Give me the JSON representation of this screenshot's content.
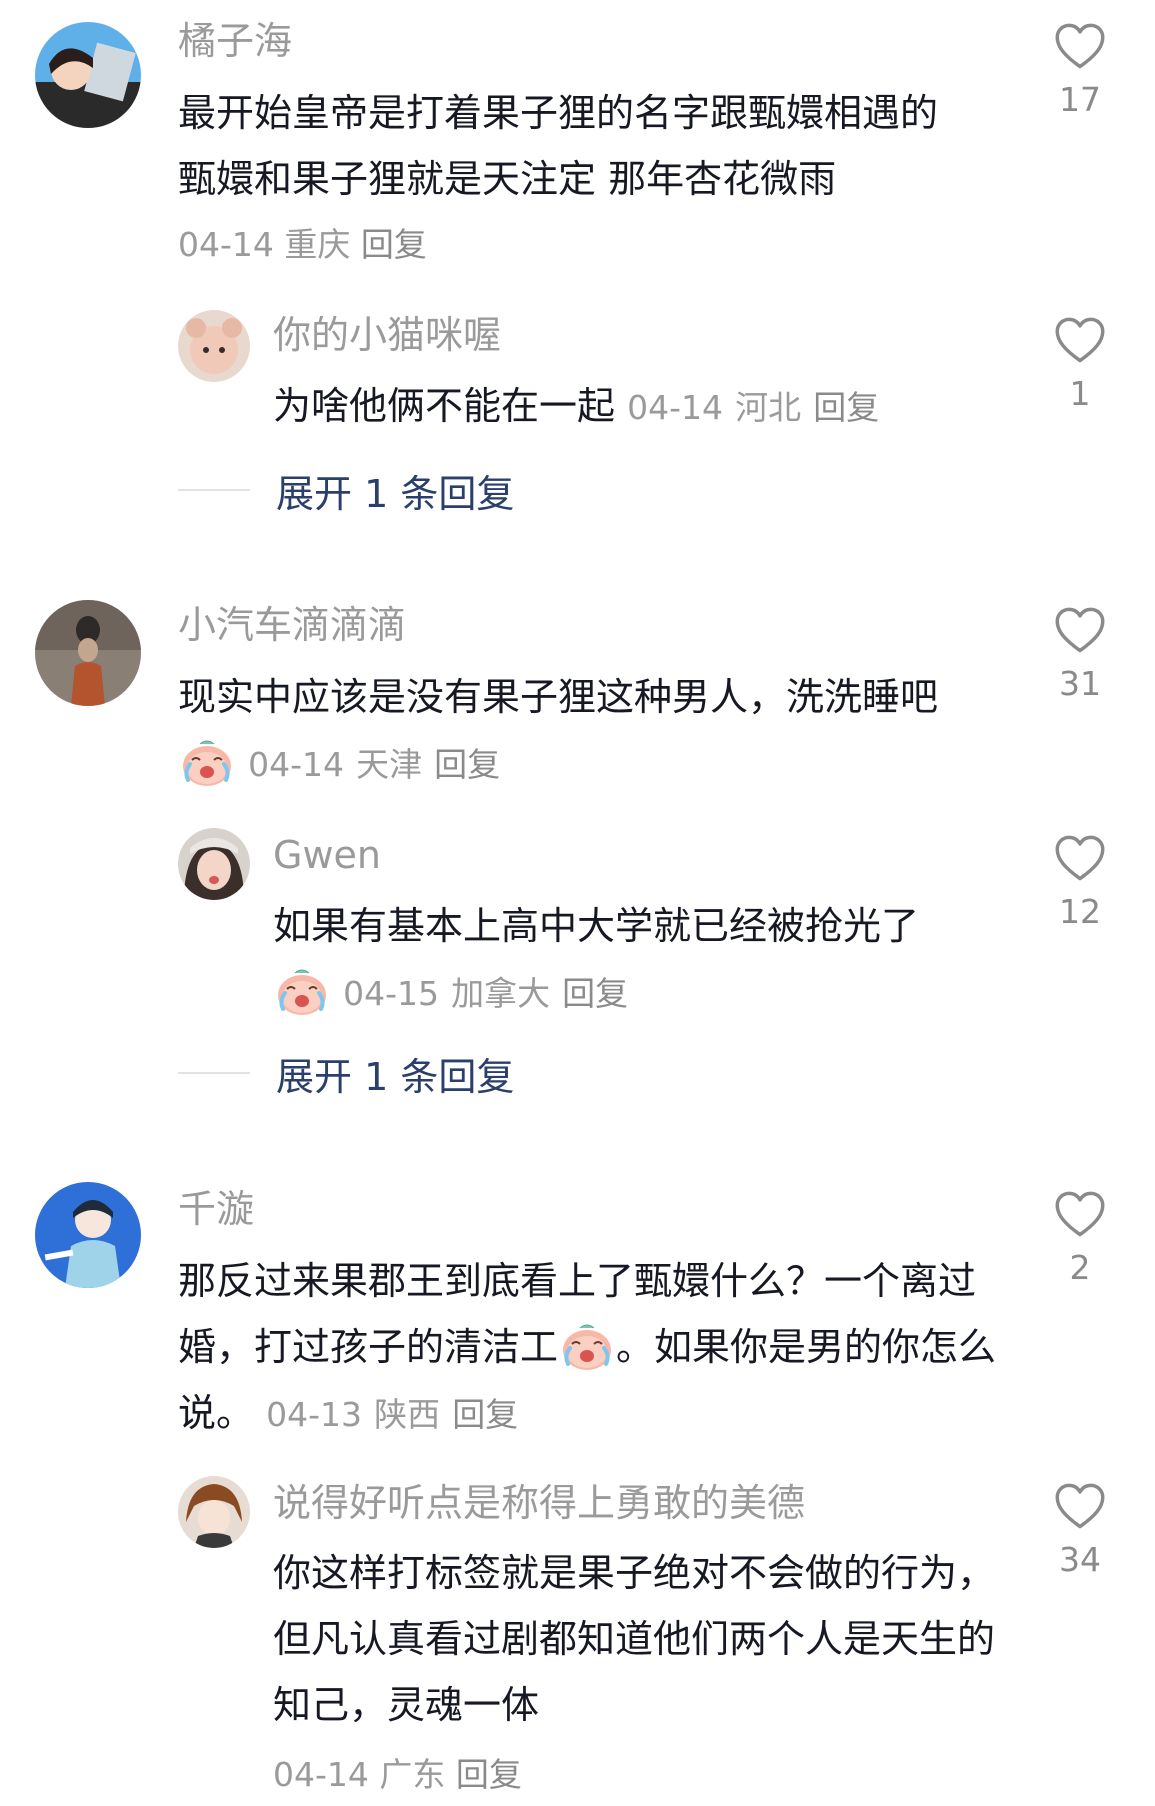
{
  "comments": [
    {
      "username": "橘子海",
      "text": "最开始皇帝是打着果子狸的名字跟甄嬛相遇的 甄嬛和果子狸就是天注定 那年杏花微雨",
      "date": "04-14",
      "location": "重庆",
      "reply_label": "回复",
      "likes": "17",
      "replies": [
        {
          "username": "你的小猫咪喔",
          "text": "为啥他俩不能在一起",
          "date": "04-14",
          "location": "河北",
          "reply_label": "回复",
          "likes": "1"
        }
      ],
      "expand_label": "展开 1 条回复"
    },
    {
      "username": "小汽车滴滴滴",
      "text": "现实中应该是没有果子狸这种男人，洗洗睡吧",
      "date": "04-14",
      "location": "天津",
      "reply_label": "回复",
      "likes": "31",
      "replies": [
        {
          "username": "Gwen",
          "text": "如果有基本上高中大学就已经被抢光了",
          "date": "04-15",
          "location": "加拿大",
          "reply_label": "回复",
          "likes": "12"
        }
      ],
      "expand_label": "展开 1 条回复"
    },
    {
      "username": "千漩",
      "text_part1": "那反过来果郡王到底看上了甄嬛什么？一个离过婚，打过孩子的清洁工",
      "text_part2": "。如果你是男的你怎么说。",
      "date": "04-13",
      "location": "陕西",
      "reply_label": "回复",
      "likes": "2",
      "replies": [
        {
          "username": "说得好听点是称得上勇敢的美德",
          "text": "你这样打标签就是果子绝对不会做的行为，但凡认真看过剧都知道他们两个人是天生的知己，灵魂一体",
          "date": "04-14",
          "location": "广东",
          "reply_label": "回复",
          "likes": "34"
        }
      ]
    }
  ],
  "icons": {
    "like": "heart-outline-icon",
    "emoji": "crying-laughing-emoji-icon"
  },
  "colors": {
    "text": "#161823",
    "meta": "#9a9a9a",
    "link": "#2a3f6b",
    "heart": "#8a8a8a"
  }
}
